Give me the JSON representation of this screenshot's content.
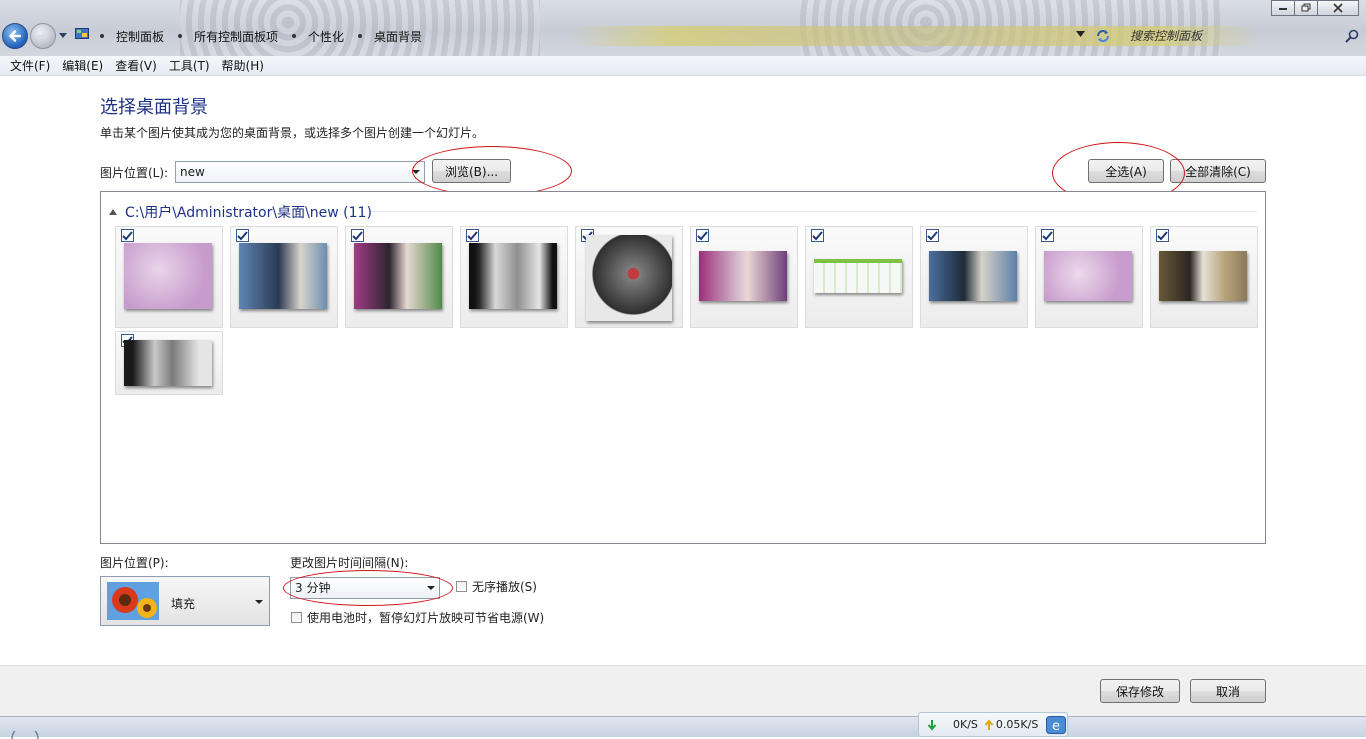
{
  "window": {
    "breadcrumbs": [
      "控制面板",
      "所有控制面板项",
      "个性化",
      "桌面背景"
    ],
    "search_placeholder": "搜索控制面板"
  },
  "menu": [
    "文件(F)",
    "编辑(E)",
    "查看(V)",
    "工具(T)",
    "帮助(H)"
  ],
  "main": {
    "title": "选择桌面背景",
    "description": "单击某个图片使其成为您的桌面背景，或选择多个图片创建一个幻灯片。",
    "location_label": "图片位置(L):",
    "location_value": "new",
    "browse_button": "浏览(B)...",
    "select_all_button": "全选(A)",
    "clear_all_button": "全部清除(C)",
    "group_title": "C:\\用户\\Administrator\\桌面\\new (11)",
    "images": [
      {
        "checked": true
      },
      {
        "checked": true
      },
      {
        "checked": true
      },
      {
        "checked": true
      },
      {
        "checked": true
      },
      {
        "checked": true
      },
      {
        "checked": true
      },
      {
        "checked": true
      },
      {
        "checked": true
      },
      {
        "checked": true
      },
      {
        "checked": true
      }
    ]
  },
  "options": {
    "position_label": "图片位置(P):",
    "position_value": "填充",
    "interval_label": "更改图片时间间隔(N):",
    "interval_value": "3 分钟",
    "shuffle_label": "无序播放(S)",
    "battery_label": "使用电池时，暂停幻灯片放映可节省电源(W)"
  },
  "footer": {
    "save_button": "保存修改",
    "cancel_button": "取消"
  },
  "netspeed": {
    "down": "0K/S",
    "up": "0.05K/S"
  },
  "colors": {
    "title_blue": "#1e3287",
    "annotation_red": "#d01414"
  }
}
